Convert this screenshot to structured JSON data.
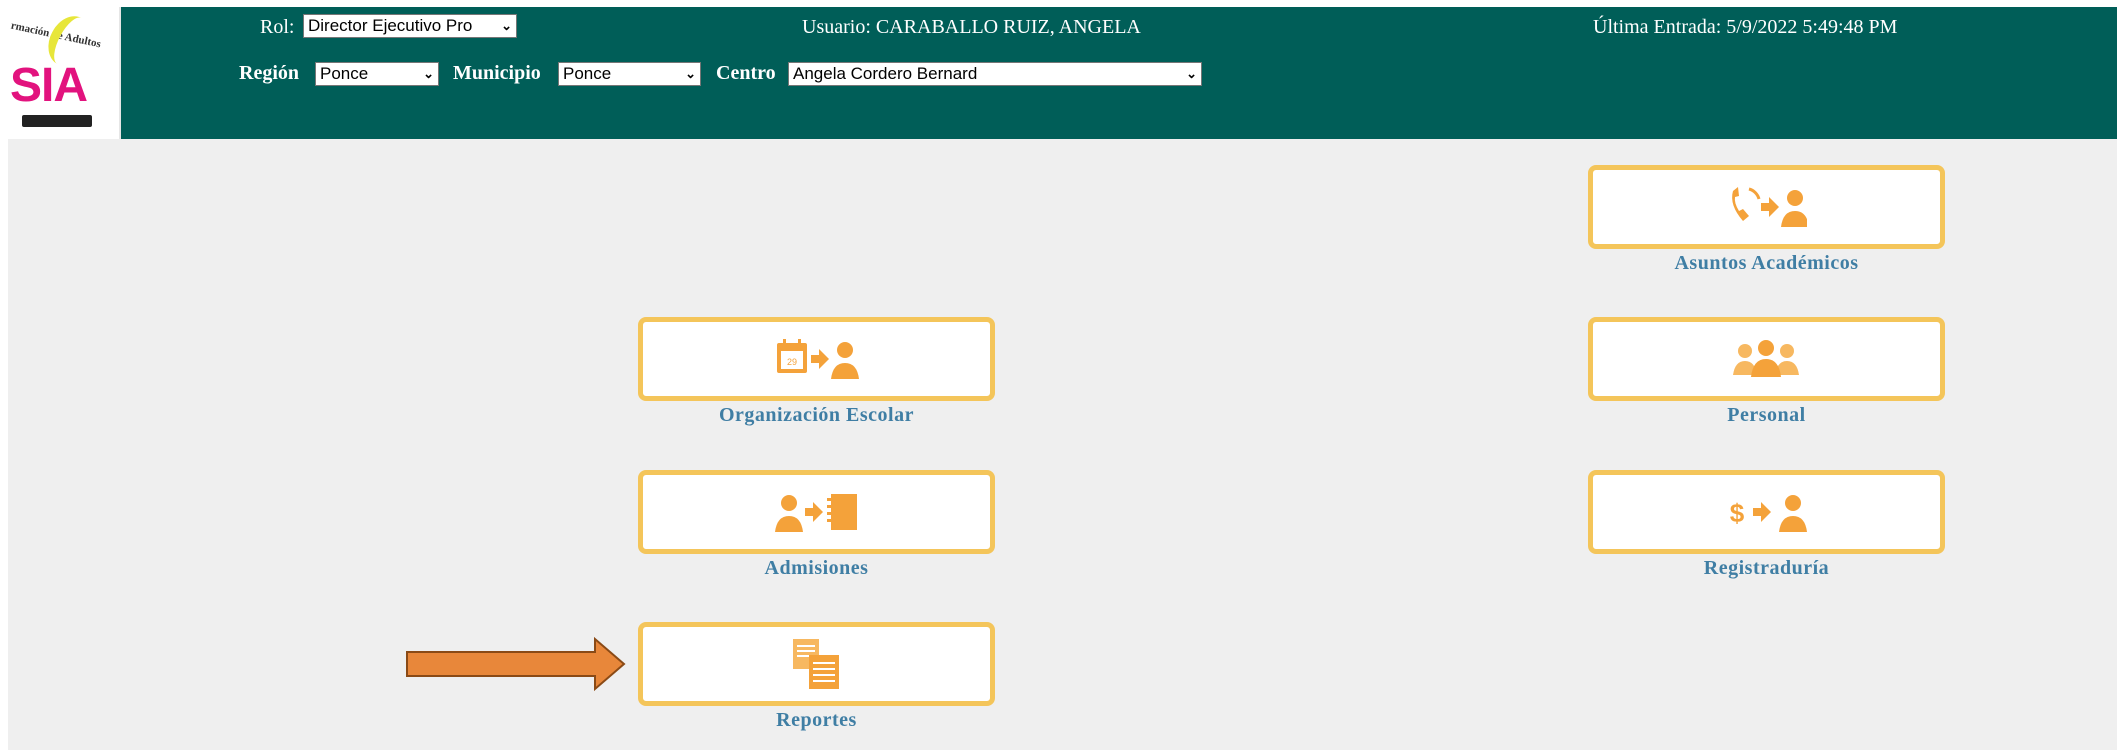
{
  "header": {
    "rol_label": "Rol:",
    "rol_value": "Director Ejecutivo Pro",
    "usuario_text": "Usuario: CARABALLO RUIZ, ANGELA",
    "ultima_entrada_text": "Última Entrada: 5/9/2022 5:49:48 PM",
    "region_label": "Región",
    "region_value": "Ponce",
    "municipio_label": "Municipio",
    "municipio_value": "Ponce",
    "centro_label": "Centro",
    "centro_value": "Angela Cordero Bernard",
    "logo_arc_text": "rmación de Adultos",
    "logo_text": "SIA"
  },
  "menu": {
    "asuntos_academicos": "Asuntos Académicos",
    "organizacion_escolar": "Organización Escolar",
    "personal": "Personal",
    "admisiones": "Admisiones",
    "registraduria": "Registraduría",
    "reportes": "Reportes"
  },
  "colors": {
    "header_bg": "#005e58",
    "tile_border": "#f4c55a",
    "label_blue": "#3f7ea4",
    "icon_orange": "#f4a23a",
    "arrow_annotation": "#e8873a"
  }
}
